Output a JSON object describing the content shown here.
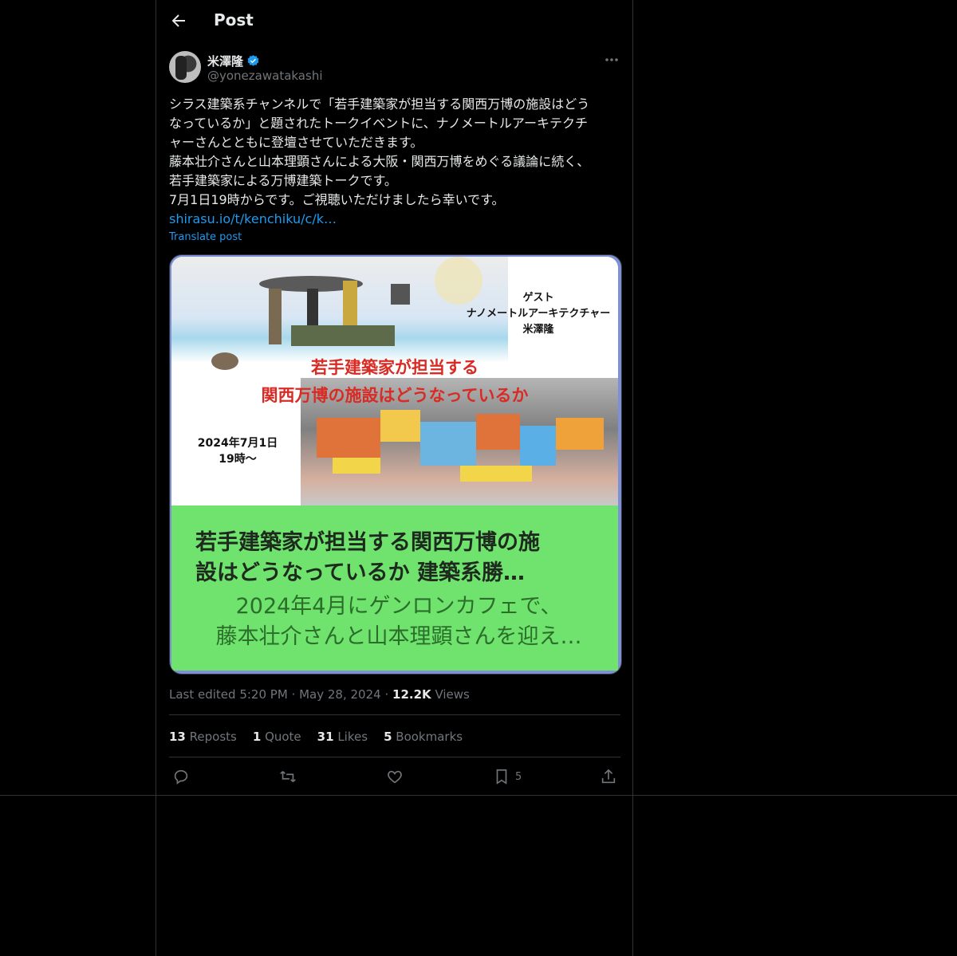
{
  "header": {
    "title": "Post"
  },
  "author": {
    "name": "米澤隆",
    "handle": "@yonezawatakashi"
  },
  "post": {
    "lines": [
      "シラス建築系チャンネルで「若手建築家が担当する関西万博の施設はどう",
      "なっているか」と題されたトークイベントに、ナノメートルアーキテクチ",
      "ャーさんとともに登壇させていただきます。",
      "藤本壮介さんと山本理顕さんによる大阪・関西万博をめぐる議論に続く、",
      "若手建築家による万博建築トークです。",
      "7月1日19時からです。ご視聴いただけましたら幸いです。"
    ],
    "link": "shirasu.io/t/kenchiku/c/k…",
    "translate": "Translate post"
  },
  "card": {
    "guest_lines": [
      "ゲスト",
      "ナノメートルアーキテクチャー",
      "米澤隆"
    ],
    "red_lines": [
      "若手建築家が担当する",
      "関西万博の施設はどうなっているか"
    ],
    "date_lines": [
      "2024年7月1日",
      "19時〜"
    ],
    "title_lines": [
      "若手建築家が担当する関西万博の施",
      "設はどうなっているか 建築系勝…"
    ],
    "desc_lines": [
      "2024年4月にゲンロンカフェで、",
      "藤本壮介さんと山本理顕さんを迎え…"
    ]
  },
  "meta": {
    "edited": "Last edited 5:20 PM",
    "date": "May 28, 2024",
    "views_count": "12.2K",
    "views_label": "Views"
  },
  "stats": {
    "reposts": {
      "count": "13",
      "label": "Reposts"
    },
    "quote": {
      "count": "1",
      "label": "Quote"
    },
    "likes": {
      "count": "31",
      "label": "Likes"
    },
    "bookmarks": {
      "count": "5",
      "label": "Bookmarks"
    }
  },
  "actions": {
    "bookmark_count": "5"
  },
  "colors": {
    "accent": "#1d9bf0",
    "verified": "#1d9bf0",
    "card_green": "#6fe36e",
    "card_red": "#d92b24"
  },
  "icons": [
    "back-arrow-icon",
    "verified-badge-icon",
    "more-icon",
    "reply-icon",
    "repost-icon",
    "like-icon",
    "bookmark-icon",
    "share-icon"
  ]
}
